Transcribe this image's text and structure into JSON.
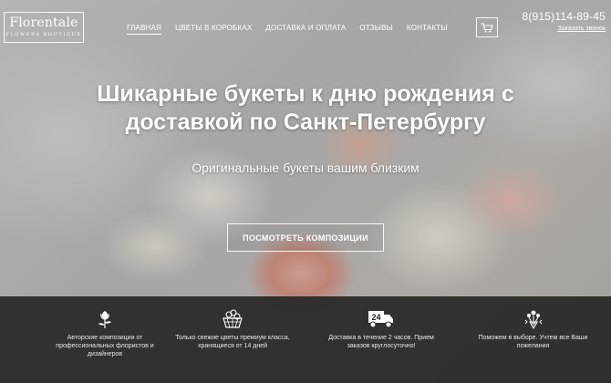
{
  "brand": {
    "name": "Florentale",
    "tagline": "FLOWERS BOUTIQUE"
  },
  "nav": {
    "items": [
      {
        "label": "ГЛАВНАЯ",
        "active": true
      },
      {
        "label": "ЦВЕТЫ В КОРОБКАХ",
        "active": false
      },
      {
        "label": "ДОСТАВКА И ОПЛАТА",
        "active": false
      },
      {
        "label": "ОТЗЫВЫ",
        "active": false
      },
      {
        "label": "КОНТАКТЫ",
        "active": false
      }
    ]
  },
  "header": {
    "cart_icon": "cart-icon",
    "phone": "8(915)114-89-45",
    "callback_label": "Заказать звонок"
  },
  "hero": {
    "title_line1": "Шикарные букеты к дню рождения с",
    "title_line2": "доставкой по Санкт-Петербургу",
    "subtitle": "Оригинальные букеты вашим близким",
    "cta_label": "ПОСМОТРЕТЬ КОМПОЗИЦИИ"
  },
  "features": [
    {
      "icon": "flower-icon",
      "line1": "Авторские композиции от",
      "line2": "профессиональных флористов и",
      "line3": "дизайнеров"
    },
    {
      "icon": "flower-basket-icon",
      "line1": "Только свежие цветы премиум класса,",
      "line2": "хранящиеся от 14 дней",
      "line3": ""
    },
    {
      "icon": "delivery-truck-24-icon",
      "badge": "24",
      "line1": "Доставка в течение 2 часов. Прием",
      "line2": "заказов круглосуточно!",
      "line3": ""
    },
    {
      "icon": "bouquet-choice-icon",
      "line1": "Поможем в выборе. Учтем все Ваши",
      "line2": "пожелания",
      "line3": ""
    }
  ],
  "colors": {
    "bar_bg": "#262626",
    "text": "#ffffff"
  }
}
